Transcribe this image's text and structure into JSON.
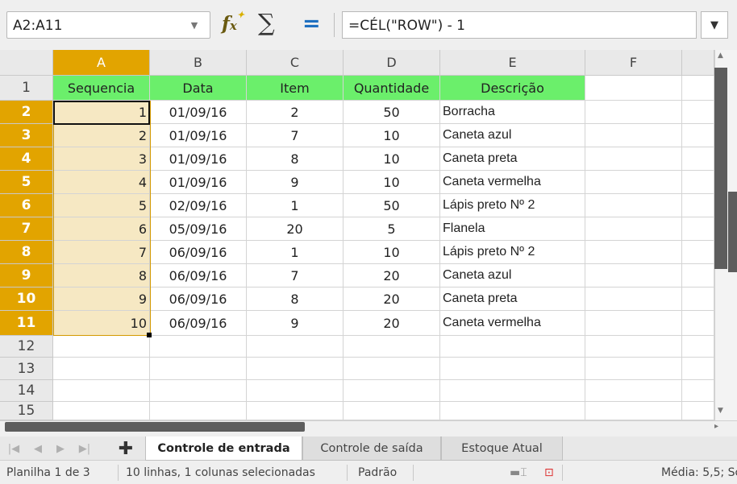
{
  "formula_bar": {
    "name_box": "A2:A11",
    "dropdown_icon": "chevron-down-icon",
    "function_wizard_icon": "fx-icon",
    "sum_icon": "sum-icon",
    "equals_icon": "equals-icon",
    "formula": "=CÉL(\"ROW\") - 1"
  },
  "columns": [
    "A",
    "B",
    "C",
    "D",
    "E",
    "F"
  ],
  "selected_column": "A",
  "rows": [
    "1",
    "2",
    "3",
    "4",
    "5",
    "6",
    "7",
    "8",
    "9",
    "10",
    "11",
    "12",
    "13",
    "14",
    "15"
  ],
  "selected_rows": [
    "2",
    "3",
    "4",
    "5",
    "6",
    "7",
    "8",
    "9",
    "10",
    "11"
  ],
  "header": [
    "Sequencia",
    "Data",
    "Item",
    "Quantidade",
    "Descrição"
  ],
  "data_rows": [
    [
      "1",
      "01/09/16",
      "2",
      "50",
      "Borracha"
    ],
    [
      "2",
      "01/09/16",
      "7",
      "10",
      "Caneta azul"
    ],
    [
      "3",
      "01/09/16",
      "8",
      "10",
      "Caneta preta"
    ],
    [
      "4",
      "01/09/16",
      "9",
      "10",
      "Caneta vermelha"
    ],
    [
      "5",
      "02/09/16",
      "1",
      "50",
      "Lápis preto Nº 2"
    ],
    [
      "6",
      "05/09/16",
      "20",
      "5",
      "Flanela"
    ],
    [
      "7",
      "06/09/16",
      "1",
      "10",
      "Lápis preto Nº 2"
    ],
    [
      "8",
      "06/09/16",
      "7",
      "20",
      "Caneta azul"
    ],
    [
      "9",
      "06/09/16",
      "8",
      "20",
      "Caneta preta"
    ],
    [
      "10",
      "06/09/16",
      "9",
      "20",
      "Caneta vermelha"
    ]
  ],
  "sheet_tabs": [
    "Controle de entrada",
    "Controle de saída",
    "Estoque Atual"
  ],
  "active_tab": "Controle de entrada",
  "status_bar": {
    "sheet": "Planilha 1 de 3",
    "selection": "10 linhas, 1 colunas selecionadas",
    "style": "Padrão",
    "summary": "Média: 5,5; Sc"
  },
  "colors": {
    "header_fill": "#6bef6b",
    "selection_accent": "#e2a400",
    "selection_fill": "#f6e8c3"
  }
}
